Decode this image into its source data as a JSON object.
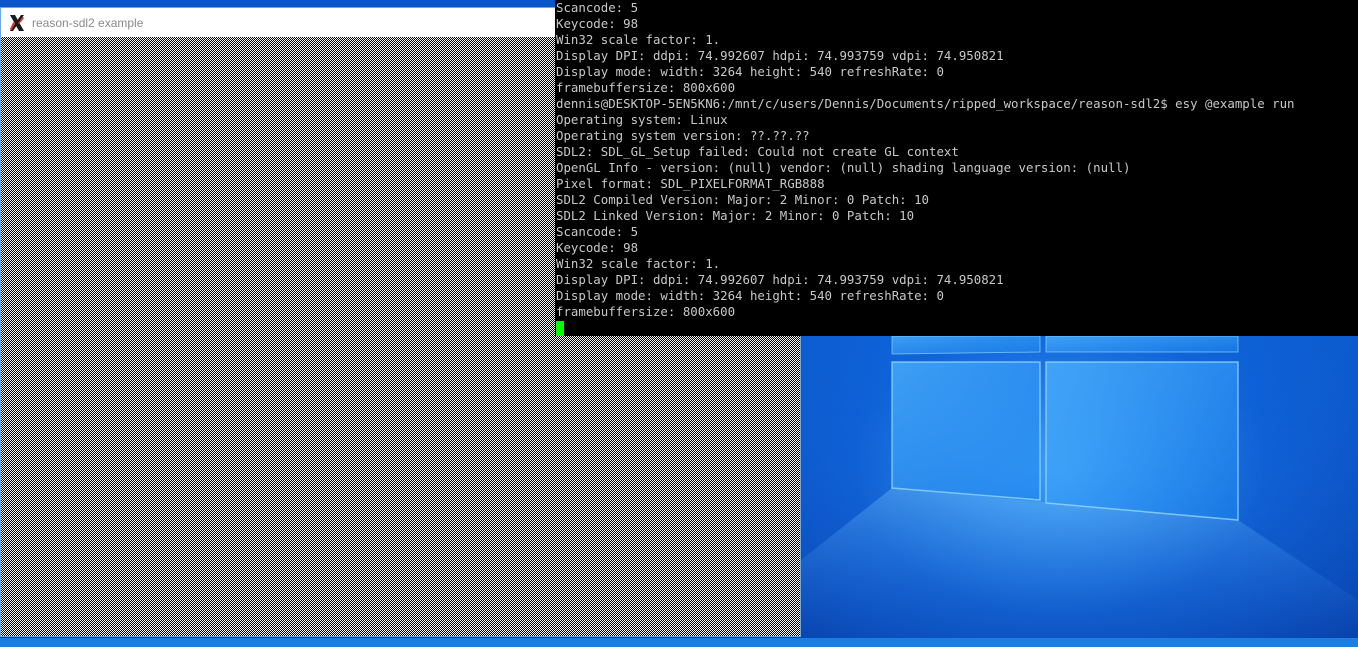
{
  "app_window": {
    "title": "reason-sdl2 example",
    "icon": "x11-icon"
  },
  "terminal": {
    "lines": [
      "Scancode: 5",
      "Keycode: 98",
      "Win32 scale factor: 1.",
      "Display DPI: ddpi: 74.992607 hdpi: 74.993759 vdpi: 74.950821",
      "Display mode: width: 3264 height: 540 refreshRate: 0",
      "framebuffersize: 800x600",
      "dennis@DESKTOP-5EN5KN6:/mnt/c/users/Dennis/Documents/ripped_workspace/reason-sdl2$ esy @example run",
      "Operating system: Linux",
      "Operating system version: ??.??.??",
      "SDL2: SDL_GL_Setup failed: Could not create GL context",
      "OpenGL Info - version: (null) vendor: (null) shading language version: (null)",
      "Pixel format: SDL_PIXELFORMAT_RGB888",
      "SDL2 Compiled Version: Major: 2 Minor: 0 Patch: 10",
      "SDL2 Linked Version: Major: 2 Minor: 0 Patch: 10",
      "Scancode: 5",
      "Keycode: 98",
      "Win32 scale factor: 1.",
      "Display DPI: ddpi: 74.992607 hdpi: 74.993759 vdpi: 74.950821",
      "Display mode: width: 3264 height: 540 refreshRate: 0",
      "framebuffersize: 800x600"
    ],
    "text_color": "#c8c8c8",
    "cursor_color": "#00ff00"
  },
  "desktop": {
    "wallpaper": "windows-logo-wallpaper",
    "accent": "#0b61d6"
  }
}
